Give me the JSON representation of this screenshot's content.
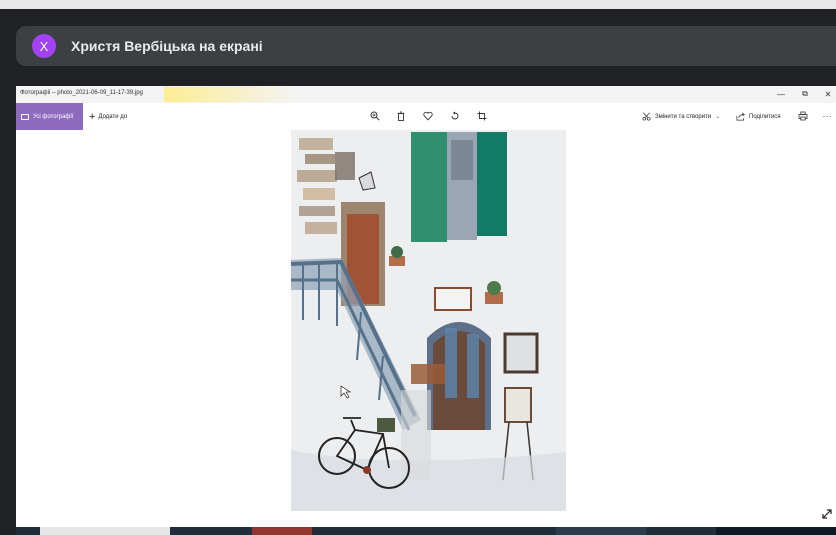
{
  "meet": {
    "avatar_letter": "Х",
    "presenter_text": "Христя Вербіцька на екрані",
    "avatar_color": "#a142f4"
  },
  "window": {
    "title": "Фотографії – photo_2021-06-09_11-17-39.jpg",
    "controls": {
      "minimize": "—",
      "maximize": "⧉",
      "close": "✕"
    }
  },
  "toolbar": {
    "all_photos_label": "Усі фотографії",
    "add_to_label": "Додати до",
    "edit_create_label": "Змінити та створити",
    "share_label": "Поділитися",
    "more_label": "···",
    "accent": "#8e6bbf",
    "icons": [
      "zoom-icon",
      "delete-icon",
      "favorite-icon",
      "rotate-icon",
      "crop-icon",
      "print-icon"
    ]
  },
  "photo": {
    "subject": "watercolor-street-bicycle"
  }
}
